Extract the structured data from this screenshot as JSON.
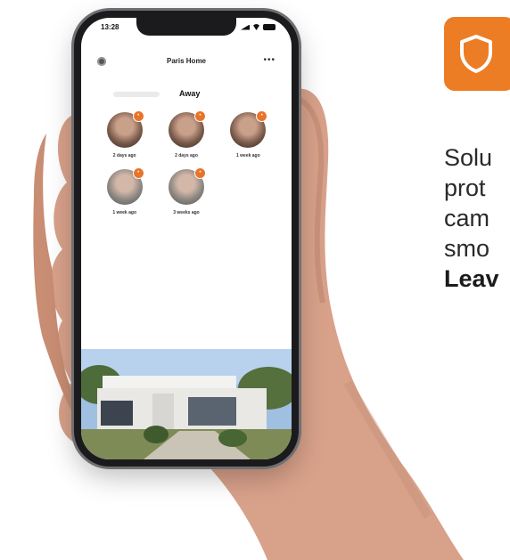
{
  "phone": {
    "status_time": "13:28",
    "home_title": "Paris Home",
    "more_label": "•••",
    "tab_active": "Away",
    "people": [
      {
        "label": "2 days ago",
        "tone": "dark"
      },
      {
        "label": "2 days ago",
        "tone": "dark"
      },
      {
        "label": "1 week ago",
        "tone": "dark"
      },
      {
        "label": "1 week ago",
        "tone": "light"
      },
      {
        "label": "3 weeks ago",
        "tone": "light"
      }
    ],
    "badge_glyph": "•",
    "page_dots": 4,
    "active_dot": 3
  },
  "brand": {
    "accent": "#ec7d25",
    "icon": "shield-icon"
  },
  "promo": {
    "lines": [
      "Solu",
      "prot",
      "cam",
      "smo"
    ],
    "bold_line": "Leav"
  }
}
